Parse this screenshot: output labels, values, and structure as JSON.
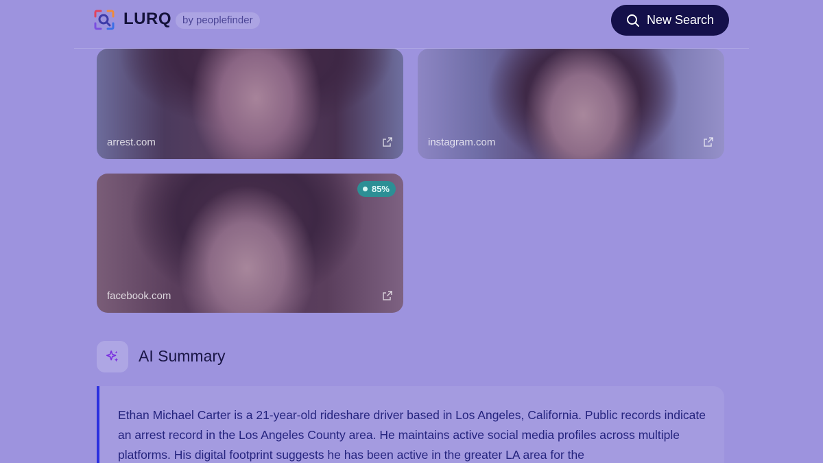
{
  "header": {
    "logo_text": "LURQ",
    "byline": "by peoplefinder",
    "new_search_label": "New Search"
  },
  "results": [
    {
      "source": "arrest.com"
    },
    {
      "source": "instagram.com"
    },
    {
      "source": "facebook.com",
      "match": "85%"
    }
  ],
  "ai_summary": {
    "title": "AI Summary",
    "text": "Ethan Michael Carter is a 21-year-old rideshare driver based in Los Angeles, California. Public records indicate an arrest record in the Los Angeles County area. He maintains active social media profiles across multiple platforms. His digital footprint suggests he has been active in the greater LA area for the"
  },
  "colors": {
    "background": "#9d93de",
    "button": "#14104a",
    "badge": "#2c8f95",
    "accent_bar": "#2b2fe0"
  },
  "icons": [
    "lurq-logo-icon",
    "search-icon",
    "external-link-icon",
    "sparkles-icon"
  ]
}
